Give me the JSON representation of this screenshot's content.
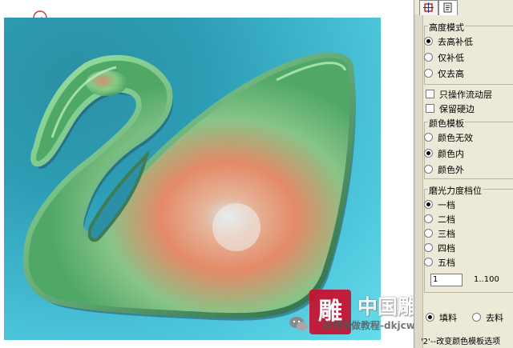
{
  "viewport": {
    "background_colors": [
      "#2c8fa3",
      "#67dcea"
    ],
    "model": "swan-relief"
  },
  "panel": {
    "height_mode": {
      "title": "高度模式",
      "options": [
        "去高补低",
        "仅补低",
        "仅去高"
      ],
      "selected": 0
    },
    "checkboxes": [
      {
        "label": "只操作流动层",
        "checked": false
      },
      {
        "label": "保留硬边",
        "checked": false
      }
    ],
    "color_template": {
      "title": "颜色模板",
      "options": [
        "颜色无效",
        "颜色内",
        "颜色外"
      ],
      "selected": 1
    },
    "polish_level": {
      "title": "磨光力度档位",
      "options": [
        "一档",
        "二档",
        "三档",
        "四档",
        "五档"
      ],
      "selected": 0
    },
    "number_value": "1",
    "number_range": "1..100",
    "partial_radio_1": "填料",
    "partial_radio_2": "去料",
    "hint": "'2'--改变颜色模板选项"
  },
  "watermark": {
    "logo_char": "雕",
    "big": "中国雕刻教程网",
    "small": "雕刻制做教程-dkjcw"
  }
}
